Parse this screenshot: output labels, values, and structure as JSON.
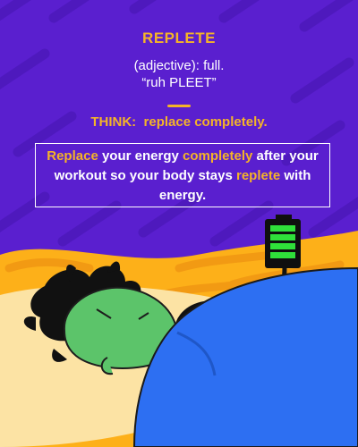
{
  "word": "REPLETE",
  "part_of_speech": "(adjective): full.",
  "pronunciation": "“ruh PLEET”",
  "think": {
    "label": "THINK:",
    "text": "replace completely."
  },
  "example": {
    "w1": "Replace",
    "t1": " your energy ",
    "w2": "completely",
    "t2": " after your workout so your body stays ",
    "w3": "replete",
    "t3": " with energy."
  },
  "colors": {
    "background": "#5a1fcf",
    "accent": "#f5b428",
    "text": "#ffffff",
    "blanket": "#2d6ff2",
    "skin": "#5cc46a",
    "battery": "#2fe03a"
  },
  "icons": [
    "battery-icon",
    "sleeping-person-illustration"
  ]
}
